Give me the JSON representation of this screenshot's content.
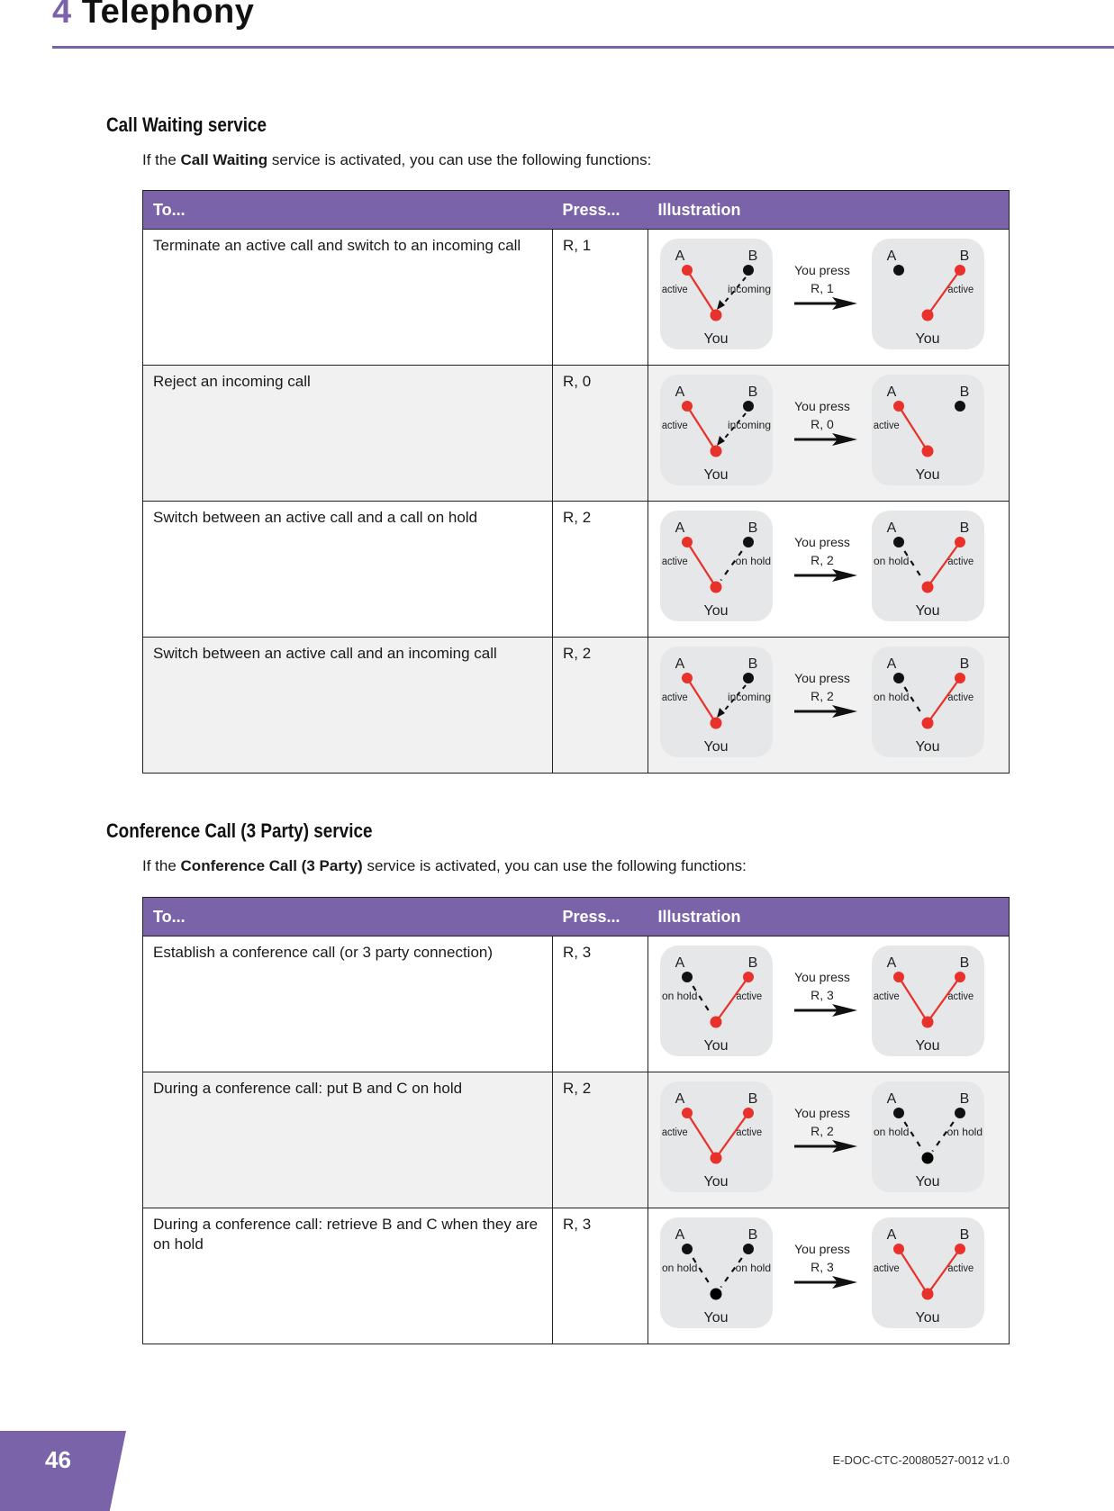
{
  "header": {
    "chapter_number": "4",
    "chapter_title": "Telephony"
  },
  "colors": {
    "accent": "#7a63a9",
    "active_line": "#e8312a",
    "row_alt": "#f1f1f2",
    "panel": "#e6e7e8"
  },
  "call_waiting": {
    "heading": "Call Waiting service",
    "intro_pre": "If the ",
    "intro_bold": "Call Waiting",
    "intro_post": " service is activated, you can use the following functions:",
    "columns": [
      "To...",
      "Press...",
      "Illustration"
    ],
    "rows": [
      {
        "to": "Terminate an active call and switch to an incoming call",
        "press": "R, 1",
        "before": {
          "a": "active",
          "b": "incoming"
        },
        "after": {
          "a": "none",
          "b": "active"
        },
        "caption1": "You press",
        "caption2": "R, 1"
      },
      {
        "to": "Reject an incoming call",
        "press": "R, 0",
        "before": {
          "a": "active",
          "b": "incoming"
        },
        "after": {
          "a": "active",
          "b": "none"
        },
        "caption1": "You press",
        "caption2": "R, 0"
      },
      {
        "to": "Switch between an active call and a call on hold",
        "press": "R, 2",
        "before": {
          "a": "active",
          "b": "on hold"
        },
        "after": {
          "a": "on hold",
          "b": "active"
        },
        "caption1": "You press",
        "caption2": "R, 2"
      },
      {
        "to": "Switch between an active call and an incoming call",
        "press": "R, 2",
        "before": {
          "a": "active",
          "b": "incoming"
        },
        "after": {
          "a": "on hold",
          "b": "active"
        },
        "caption1": "You press",
        "caption2": "R, 2"
      }
    ]
  },
  "conference": {
    "heading": "Conference Call (3 Party) service",
    "intro_pre": "If the ",
    "intro_bold": "Conference Call (3 Party)",
    "intro_post": " service is activated, you can use the following functions:",
    "columns": [
      "To...",
      "Press...",
      "Illustration"
    ],
    "rows": [
      {
        "to": "Establish a conference call (or 3 party connection)",
        "press": "R, 3",
        "before": {
          "a": "on hold",
          "b": "active"
        },
        "after": {
          "a": "active",
          "b": "active"
        },
        "caption1": "You press",
        "caption2": "R, 3"
      },
      {
        "to": "During a conference call: put B and C on hold",
        "press": "R, 2",
        "before": {
          "a": "active",
          "b": "active"
        },
        "after": {
          "a": "on hold",
          "b": "on hold"
        },
        "caption1": "You press",
        "caption2": "R, 2"
      },
      {
        "to": "During a conference call: retrieve B and C when they are on hold",
        "press": "R, 3",
        "before": {
          "a": "on hold",
          "b": "on hold"
        },
        "after": {
          "a": "active",
          "b": "active"
        },
        "caption1": "You press",
        "caption2": "R, 3"
      }
    ]
  },
  "diagram_labels": {
    "a": "A",
    "b": "B",
    "you": "You"
  },
  "footer": {
    "page_number": "46",
    "doc_id": "E-DOC-CTC-20080527-0012 v1.0"
  }
}
